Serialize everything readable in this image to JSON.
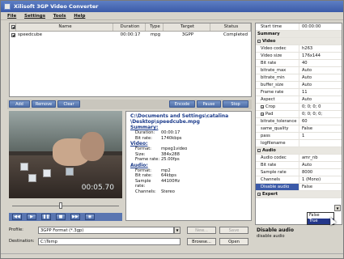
{
  "window": {
    "title": "Xilisoft 3GP Video Converter"
  },
  "menu": [
    "File",
    "Settings",
    "Tools",
    "Help"
  ],
  "table": {
    "headers": [
      "Name",
      "Duration",
      "Type",
      "Target",
      "Status"
    ],
    "rows": [
      {
        "name": "speedcube",
        "duration": "00:00:17",
        "type": "mpg",
        "target": "3GPP",
        "status": "Completed",
        "checked": true
      }
    ]
  },
  "toolbar": {
    "buttons": [
      "Add",
      "Remove",
      "Clear",
      "Encode",
      "Pause",
      "Stop"
    ]
  },
  "player": {
    "time": "00:05.70",
    "position": 0.45
  },
  "info": {
    "path_line1": "C:\\Documents and Settings\\catalina",
    "path_line2": "\\Desktop\\speedcube.mpg",
    "summary_title": "Summary:",
    "summary": [
      [
        "Duration:",
        "00:00:17"
      ],
      [
        "Bit rate:",
        "1740kbps"
      ]
    ],
    "video_title": "Video:",
    "video": [
      [
        "Format:",
        "mpeg1video"
      ],
      [
        "Size:",
        "384x288"
      ],
      [
        "Frame rate:",
        "25.00fps"
      ]
    ],
    "audio_title": "Audio:",
    "audio": [
      [
        "Format:",
        "mp2"
      ],
      [
        "Bit rate:",
        "64kbps"
      ],
      [
        "Sample rate:",
        "44100Hz"
      ],
      [
        "Channels:",
        "Stereo"
      ]
    ]
  },
  "profile": {
    "label": "Profile:",
    "value": "3GPP Format (*.3gp)",
    "new_button": "New...",
    "save_button": "Save"
  },
  "destination": {
    "label": "Destination:",
    "value": "C:\\Temp",
    "browse_button": "Browse...",
    "open_button": "Open"
  },
  "properties": [
    {
      "k": "Start time",
      "v": "00:00:00"
    },
    {
      "k": "Summary",
      "cat": true
    },
    {
      "k": "Video",
      "cat": true,
      "sq": "-"
    },
    {
      "k": "Video codec",
      "v": "h263"
    },
    {
      "k": "Video size",
      "v": "176x144"
    },
    {
      "k": "Bit rate",
      "v": "40"
    },
    {
      "k": "bitrate_max",
      "v": "Auto"
    },
    {
      "k": "bitrate_min",
      "v": "Auto"
    },
    {
      "k": "buffer_size",
      "v": "Auto"
    },
    {
      "k": "Frame rate",
      "v": "11"
    },
    {
      "k": "Aspect",
      "v": "Auto"
    },
    {
      "k": "Crop",
      "v": "0; 0; 0; 0",
      "sq": "+"
    },
    {
      "k": "Pad",
      "v": "0; 0; 0; 0;",
      "sq": "+"
    },
    {
      "k": "bitrate_tolerance",
      "v": "60"
    },
    {
      "k": "same_quality",
      "v": "False"
    },
    {
      "k": "pass",
      "v": "1"
    },
    {
      "k": "logfilename",
      "v": ""
    },
    {
      "k": "Audio",
      "cat": true,
      "sq": "-"
    },
    {
      "k": "Audio codec",
      "v": "amr_nb"
    },
    {
      "k": "Bit rate",
      "v": "Auto"
    },
    {
      "k": "Sample rate",
      "v": "8000"
    },
    {
      "k": "Channels",
      "v": "1 (Mono)"
    },
    {
      "k": "Disable audio",
      "v": "False",
      "sel": true
    },
    {
      "k": "Expert",
      "cat": true,
      "sq": "+"
    }
  ],
  "dropdown_options": [
    "False",
    "True"
  ],
  "description": {
    "title": "Disable audio",
    "text": "disable audio"
  }
}
